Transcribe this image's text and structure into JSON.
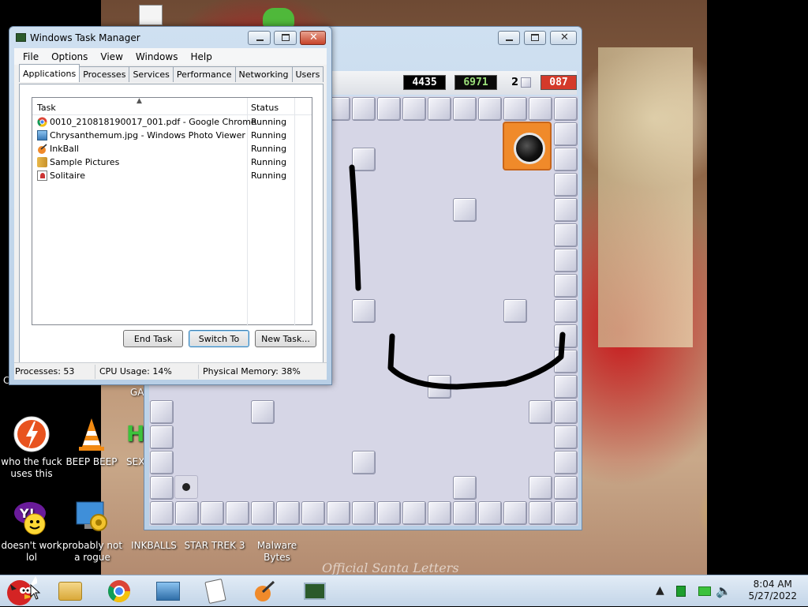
{
  "taskmgr": {
    "title": "Windows Task Manager",
    "menu": [
      "File",
      "Options",
      "View",
      "Windows",
      "Help"
    ],
    "tabs": [
      "Applications",
      "Processes",
      "Services",
      "Performance",
      "Networking",
      "Users"
    ],
    "columns": {
      "task": "Task",
      "status": "Status"
    },
    "rows": [
      {
        "name": "0010_210818190017_001.pdf - Google Chrome",
        "status": "Running",
        "icon": "chrome-icon"
      },
      {
        "name": "Chrysanthemum.jpg - Windows Photo Viewer",
        "status": "Running",
        "icon": "photo-viewer-icon"
      },
      {
        "name": "InkBall",
        "status": "Running",
        "icon": "inkball-icon"
      },
      {
        "name": "Sample Pictures",
        "status": "Running",
        "icon": "folder-icon"
      },
      {
        "name": "Solitaire",
        "status": "Running",
        "icon": "solitaire-icon"
      }
    ],
    "buttons": {
      "end_task": "End Task",
      "switch_to": "Switch To",
      "new_task": "New Task..."
    },
    "status": {
      "processes": "Processes: 53",
      "cpu": "CPU Usage: 14%",
      "memory": "Physical Memory: 38%"
    }
  },
  "inkball": {
    "scores": {
      "score": "4435",
      "timer": "6971",
      "level": "2",
      "remaining": "087"
    },
    "colors": {
      "score_bg": "#000000",
      "timer_bg": "#0a0a0a",
      "timer_fg": "#9be07a",
      "remaining_bg": "#d43a2a",
      "hole": "#f08a2a"
    }
  },
  "desktop": {
    "icons": [
      {
        "label": "who the fuck uses this",
        "icon": "lightning-icon"
      },
      {
        "label": "BEEP BEEP",
        "icon": "vlc-cone-icon"
      },
      {
        "label": "SEX",
        "icon": "green-h-icon"
      },
      {
        "label": "doesn't work lol",
        "icon": "yahoo-messenger-icon"
      },
      {
        "label": "probably not a rogue",
        "icon": "monitor-gear-icon"
      },
      {
        "label": "INKBALLS",
        "icon": "inkball-icon"
      },
      {
        "label": "STAR TREK 3",
        "icon": "startrek-icon"
      },
      {
        "label": "Malware Bytes",
        "icon": "malwarebytes-icon"
      }
    ],
    "partial_labels": {
      "left_c": "C",
      "ga": "GA"
    },
    "watermark": "Official Santa Letters"
  },
  "taskbar": {
    "apps": [
      "angry-birds-icon",
      "explorer-folder-icon",
      "chrome-icon",
      "photo-viewer-icon",
      "solitaire-icon",
      "inkball-icon",
      "task-manager-icon"
    ],
    "clock": {
      "time": "8:04 AM",
      "date": "5/27/2022"
    }
  }
}
